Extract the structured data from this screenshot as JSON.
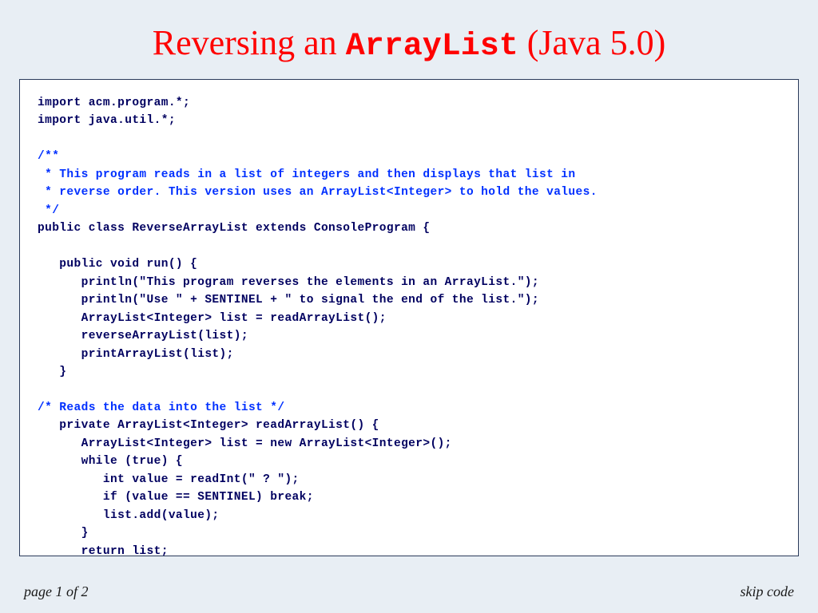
{
  "title": {
    "part1": "Reversing an ",
    "mono": "ArrayList",
    "part2": " (Java 5.0)"
  },
  "code": {
    "l1": "import acm.program.*;",
    "l2": "import java.util.*;",
    "l3": "",
    "c1": "/**",
    "c2": " * This program reads in a list of integers and then displays that list in",
    "c3": " * reverse order. This version uses an ArrayList<Integer> to hold the values.",
    "c4": " */",
    "l4": "public class ReverseArrayList extends ConsoleProgram {",
    "l5": "",
    "l6": "   public void run() {",
    "l7": "      println(\"This program reverses the elements in an ArrayList.\");",
    "l8": "      println(\"Use \" + SENTINEL + \" to signal the end of the list.\");",
    "l9": "      ArrayList<Integer> list = readArrayList();",
    "l10": "      reverseArrayList(list);",
    "l11": "      printArrayList(list);",
    "l12": "   }",
    "l13": "",
    "c5": "/* Reads the data into the list */",
    "l14": "   private ArrayList<Integer> readArrayList() {",
    "l15": "      ArrayList<Integer> list = new ArrayList<Integer>();",
    "l16": "      while (true) {",
    "l17": "         int value = readInt(\" ? \");",
    "l18": "         if (value == SENTINEL) break;",
    "l19": "         list.add(value);",
    "l20": "      }",
    "l21": "      return list;",
    "l22": "   }"
  },
  "footer": {
    "left": "page 1 of 2",
    "right": "skip code"
  }
}
